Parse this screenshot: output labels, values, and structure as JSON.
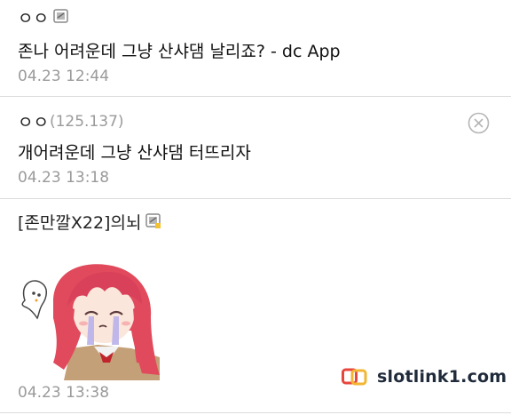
{
  "comments": [
    {
      "nickname": "ㅇㅇ",
      "content": "존나 어려운데 그냥 산샤댐 날리죠? - dc App",
      "date": "04.23 12:44",
      "has_member_icon": true
    },
    {
      "nickname": "ㅇㅇ",
      "ip": "(125.137)",
      "content": "개어려운데 그냥 산샤댐 터뜨리자",
      "date": "04.23 13:18",
      "has_delete_button": true
    },
    {
      "nickname": "[존만깔X22]의뇌",
      "has_member_icon": true,
      "sticker": "crying-girl-dccon",
      "date": "04.23 13:38"
    }
  ],
  "watermark": {
    "text": "slotlink1.com",
    "logo_color": "#e8453c"
  },
  "colors": {
    "divider": "#dcdcdc",
    "meta_text": "#9a9a9a",
    "main_text": "#111111"
  }
}
